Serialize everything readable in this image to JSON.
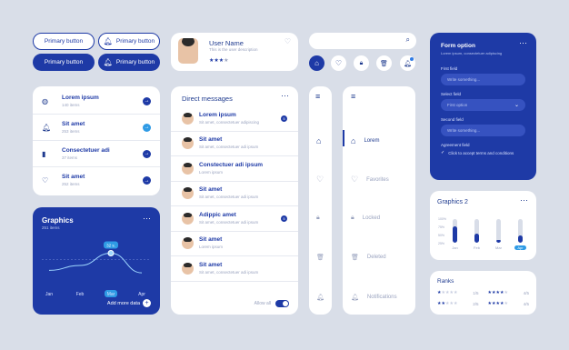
{
  "buttons": {
    "primary": "Primary button"
  },
  "profile": {
    "name": "User Name",
    "desc": "This is the user description",
    "rating": 4
  },
  "list": [
    {
      "title": "Lorem ipsum",
      "sub": "140 items",
      "icon": "basketball-icon"
    },
    {
      "title": "Sit amet",
      "sub": "253 items",
      "icon": "bell-icon"
    },
    {
      "title": "Consectetuer adi",
      "sub": "37 items",
      "icon": "bar-chart-icon"
    },
    {
      "title": "Sit amet",
      "sub": "252 items",
      "icon": "heart-icon"
    }
  ],
  "graphics": {
    "title": "Graphics",
    "sub": "251 items",
    "tooltip": "32 s.",
    "months": [
      "Jan",
      "Feb",
      "Mar",
      "Apr"
    ],
    "add": "Add more data",
    "values": [
      28,
      40,
      70,
      22
    ]
  },
  "dm": {
    "title": "Direct messages",
    "items": [
      {
        "name": "Lorem ipsum",
        "text": "Sit amet, consectetuer adipiscing",
        "badge": "5"
      },
      {
        "name": "Sit amet",
        "text": "Sit amet, consectetuer adi ipsum",
        "badge": ""
      },
      {
        "name": "Constectuer adi ipsum",
        "text": "Lorem ipsum",
        "badge": ""
      },
      {
        "name": "Sit amet",
        "text": "Sit amet, consectetuer adi ipsum",
        "badge": ""
      },
      {
        "name": "Adippic amet",
        "text": "Sit amet, consectetuer adi ipsum",
        "badge": "5"
      },
      {
        "name": "Sit amet",
        "text": "Lorem ipsum",
        "badge": ""
      },
      {
        "name": "Sit amet",
        "text": "Sit amet, consectetuer adi ipsum",
        "badge": ""
      }
    ],
    "allow": "Allow all"
  },
  "nav": [
    "Lorem",
    "Favorites",
    "Locked",
    "Deleted",
    "Notifications"
  ],
  "form": {
    "title": "Form option",
    "sub": "Lorem ipsum, consectetuer adipiscing",
    "first": "First field",
    "first_ph": "Write something...",
    "select": "Select field",
    "select_val": "First option",
    "second": "Second field",
    "second_ph": "Write something...",
    "agreement": "Agreement field",
    "agree_text": "Click to accept terms and conditions"
  },
  "graphics2": {
    "title": "Graphics 2",
    "yticks": [
      "100%",
      "75%",
      "50%",
      "25%"
    ],
    "months": [
      "Jan",
      "Feb",
      "Mar",
      "Apr"
    ],
    "values": [
      70,
      40,
      10,
      30
    ]
  },
  "ranks": {
    "title": "Ranks",
    "items": [
      {
        "stars": 1,
        "label": "1/5"
      },
      {
        "stars": 4,
        "label": "4/5"
      },
      {
        "stars": 2,
        "label": "2/5"
      },
      {
        "stars": 4,
        "label": "4/5"
      }
    ]
  },
  "colors": {
    "accent": "#1e3aa6",
    "bg": "#d9dee8"
  }
}
